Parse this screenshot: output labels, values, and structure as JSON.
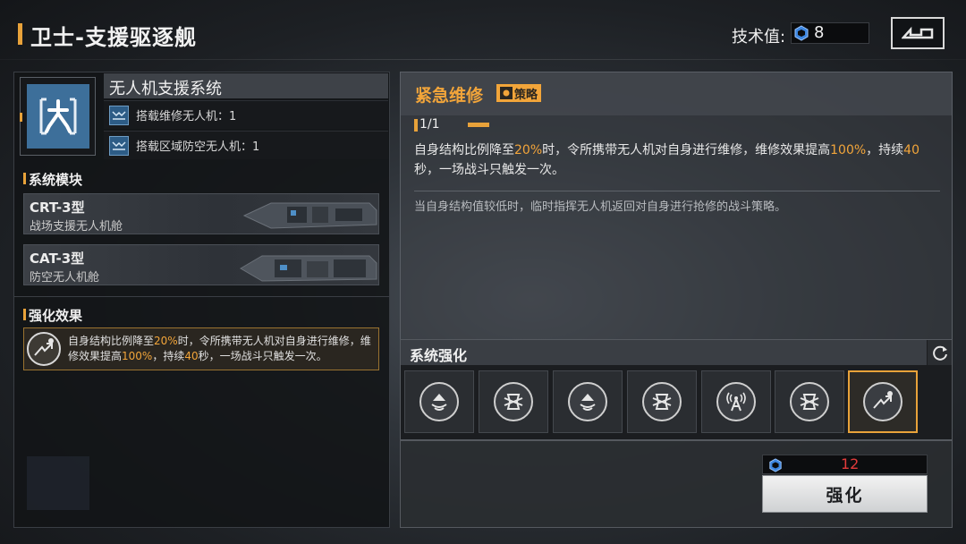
{
  "header": {
    "title": "卫士-支援驱逐舰",
    "tech_label": "技术值:",
    "tech_value": "8",
    "back_icon": "back-arrow-icon"
  },
  "system": {
    "name": "无人机支援系统",
    "icon": "drone-system-icon",
    "drones": [
      {
        "label": "搭载维修无人机：1",
        "icon": "drone-icon"
      },
      {
        "label": "搭载区域防空无人机：1",
        "icon": "drone-icon"
      }
    ]
  },
  "modules": {
    "section_title": "系统模块",
    "items": [
      {
        "name": "CRT-3型",
        "desc": "战场支援无人机舱"
      },
      {
        "name": "CAT-3型",
        "desc": "防空无人机舱"
      }
    ]
  },
  "effect": {
    "section_title": "强化效果",
    "icon": "repair-strategy-icon",
    "text_parts": [
      "自身结构比例降至",
      "20%",
      "时，令所携带无人机对自身进行维修，维修效果提高",
      "100%",
      "，持续",
      "40",
      "秒，一场战斗只触发一次。"
    ]
  },
  "detail": {
    "skill_name": "紧急维修",
    "tag": "策略",
    "level": "1/1",
    "level_progress": 1.0,
    "desc_parts": [
      "自身结构比例降至",
      "20%",
      "时，令所携带无人机对自身进行维修，维修效果提高",
      "100%",
      "，持续",
      "40",
      "秒，一场战斗只触发一次。"
    ],
    "flavor": "当自身结构值较低时，临时指挥无人机返回对自身进行抢修的战斗策略。"
  },
  "enhancement": {
    "title": "系统强化",
    "refresh_icon": "refresh-icon",
    "slots": [
      {
        "icon": "signal-boost-icon",
        "active": false
      },
      {
        "icon": "shield-cross-icon",
        "active": false
      },
      {
        "icon": "signal-boost-icon",
        "active": false
      },
      {
        "icon": "shield-cross-icon",
        "active": false
      },
      {
        "icon": "radar-tower-icon",
        "active": false
      },
      {
        "icon": "shield-cross-icon",
        "active": false
      },
      {
        "icon": "repair-strategy-icon",
        "active": true
      }
    ]
  },
  "upgrade": {
    "cost_icon": "tech-point-icon",
    "cost": "12",
    "button_label": "强化"
  },
  "colors": {
    "accent": "#e8a23a",
    "highlight": "#f2a53a",
    "insufficient": "#e23b3b",
    "tech_blue": "#3d86e0"
  }
}
